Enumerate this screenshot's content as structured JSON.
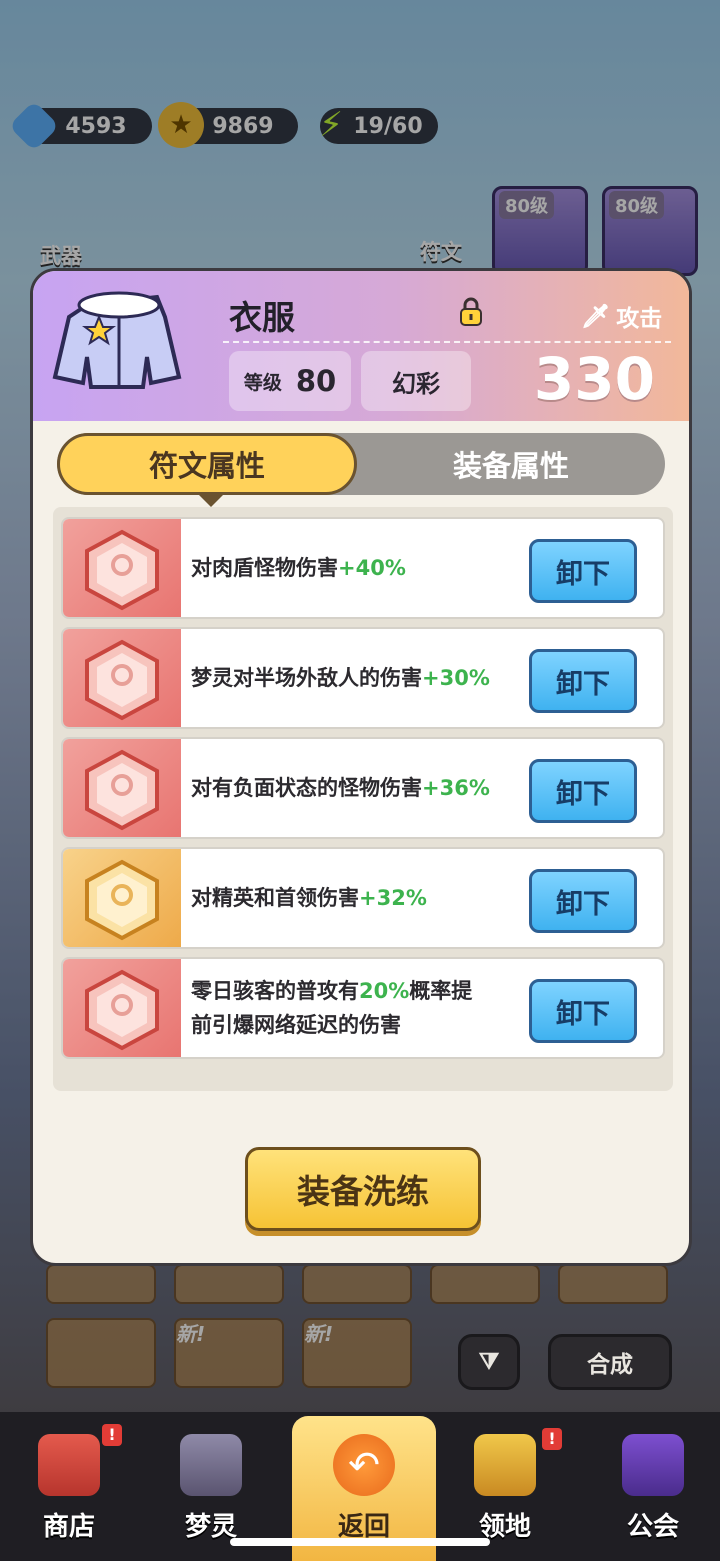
{
  "resources": {
    "gems": "4593",
    "coins": "9869",
    "energy": "19/60"
  },
  "side_labels": {
    "weapon": "武器",
    "rune": "符文"
  },
  "level_cards": [
    "80级",
    "80级"
  ],
  "item": {
    "name": "衣服",
    "slot_type": "攻击",
    "level_label": "等级",
    "level_value": "80",
    "quality": "幻彩",
    "power": "330"
  },
  "tabs": {
    "active": "符文属性",
    "inactive": "装备属性"
  },
  "runes": [
    {
      "color": "red",
      "text": "对肉盾怪物伤害",
      "bonus": "+40%",
      "button": "卸下"
    },
    {
      "color": "red",
      "text": "梦灵对半场外敌人的伤害",
      "bonus": "+30%",
      "button": "卸下"
    },
    {
      "color": "red",
      "text": "对有负面状态的怪物伤害",
      "bonus": "+36%",
      "button": "卸下"
    },
    {
      "color": "gold",
      "text": "对精英和首领伤害",
      "bonus": "+32%",
      "button": "卸下"
    },
    {
      "color": "red",
      "line1_pre": "零日骇客的普攻有",
      "line1_pct": "20%",
      "line1_post": "概率提",
      "line2": "前引爆网络延迟的伤害",
      "button": "卸下"
    }
  ],
  "refine_button": "装备洗练",
  "bottom": {
    "new_tag": "新!",
    "merge_button": "合成"
  },
  "nav": [
    {
      "label": "商店",
      "badge": "!"
    },
    {
      "label": "梦灵"
    },
    {
      "label": "返回"
    },
    {
      "label": "领地",
      "badge": "!"
    },
    {
      "label": "公会"
    }
  ],
  "colors": {
    "bonus_green": "#3db34e",
    "tab_active": "#ffd25a",
    "unequip_blue": "#3fb2f0",
    "refine_yellow": "#f6c335"
  }
}
